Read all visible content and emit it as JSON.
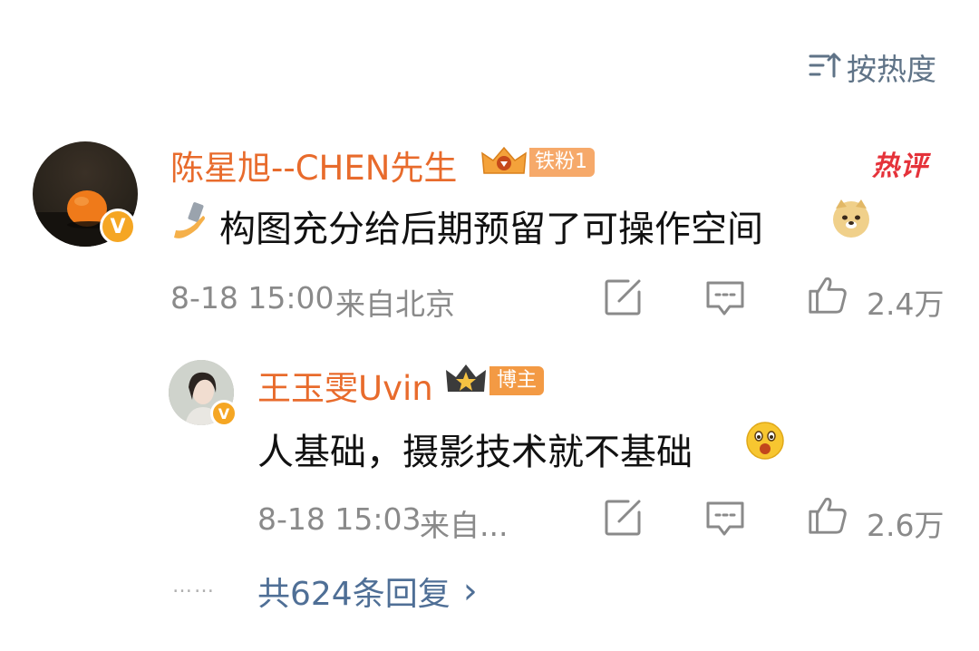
{
  "sort": {
    "icon": "sort-lines-arrow-icon",
    "label": "按热度"
  },
  "comment": {
    "username": "陈星旭--CHEN先生",
    "fan_badge": "铁粉1",
    "hot_tag": "热评",
    "text": "构图充分给后期预留了可操作空间",
    "datetime": "8-18 15:00",
    "location": "来自北京",
    "likes": "2.4万",
    "accent_color": "#e86b2c"
  },
  "reply": {
    "username": "王玉雯Uvin",
    "badge": "博主",
    "text": "人基础，摄影技术就不基础",
    "datetime": "8-18 15:03",
    "location": "来自...",
    "likes": "2.6万"
  },
  "more_replies": {
    "dots": "……",
    "label": "共624条回复",
    "chevron": "›"
  },
  "colors": {
    "link_blue": "#4f6f96",
    "username_orange": "#e86b2c",
    "meta_gray": "#8a8a8a",
    "hot_red": "#e5323a"
  }
}
